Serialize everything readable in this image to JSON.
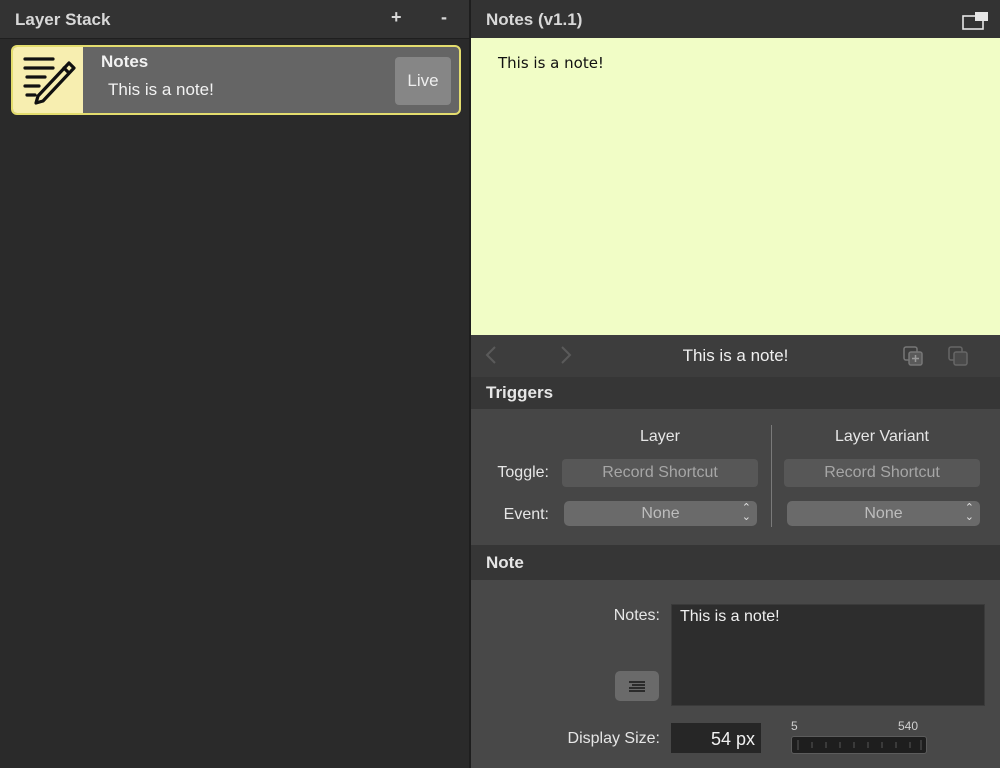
{
  "layer_stack": {
    "title": "Layer Stack",
    "add_label": "+",
    "remove_label": "-",
    "items": [
      {
        "name": "Notes",
        "subtitle": "This is a note!",
        "live_label": "Live",
        "icon": "notes-pencil-icon"
      }
    ]
  },
  "inspector": {
    "title": "Notes (v1.1)",
    "popout_icon": "popout-window-icon",
    "preview_text": "This is a note!",
    "nav": {
      "current": "This is a note!",
      "back_icon": "chevron-left-icon",
      "forward_icon": "chevron-right-icon",
      "duplicate_icon": "duplicate-icon",
      "copy_icon": "copy-icon"
    },
    "triggers": {
      "title": "Triggers",
      "col_layer": "Layer",
      "col_variant": "Layer Variant",
      "toggle_label": "Toggle:",
      "event_label": "Event:",
      "record_layer": "Record Shortcut",
      "record_variant": "Record Shortcut",
      "event_layer": "None",
      "event_variant": "None"
    },
    "note": {
      "title": "Note",
      "notes_label": "Notes:",
      "notes_value": "This is a note!",
      "align_icon": "text-align-icon",
      "display_size_label": "Display Size:",
      "display_size_value": "54 px",
      "slider_min": "5",
      "slider_max": "540"
    }
  },
  "colors": {
    "preview_bg": "#f1fdc6",
    "selection_border": "#e4dd6e",
    "icon_bg": "#f7eeb0"
  }
}
